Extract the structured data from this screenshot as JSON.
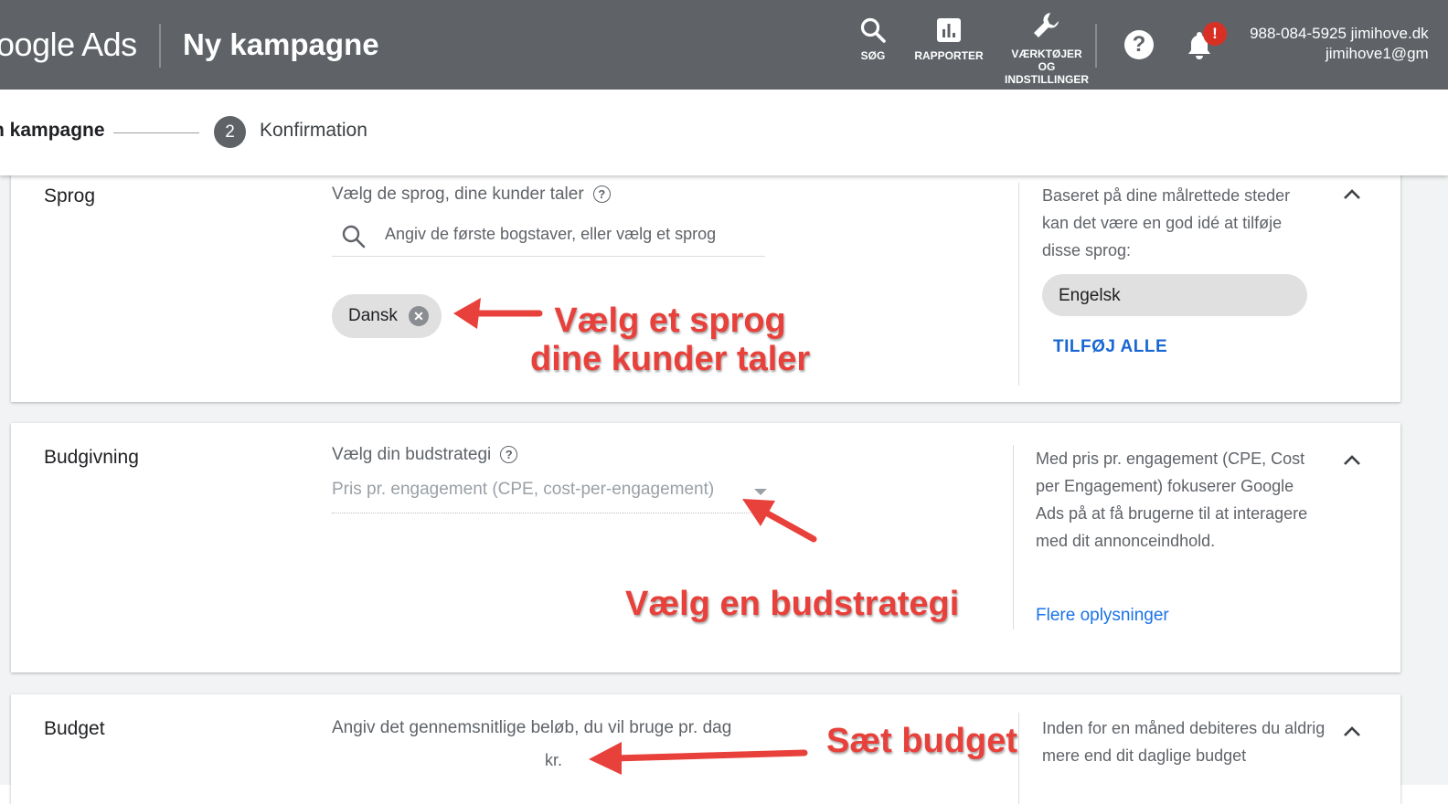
{
  "header": {
    "logo": "oogle Ads",
    "page_title": "Ny kampagne",
    "tools": [
      {
        "label": "SØG",
        "icon": "search-icon"
      },
      {
        "label": "RAPPORTER",
        "icon": "reports-icon"
      },
      {
        "label": "VÆRKTØJER\nOG\nINDSTILLINGER",
        "icon": "wrench-icon"
      }
    ],
    "help_icon": "?",
    "notification_badge": "!",
    "account_line1": "988-084-5925 jimihove.dk",
    "account_line2": "jimihove1@gm"
  },
  "stepper": {
    "step1_label": "n kampagne",
    "step2_number": "2",
    "step2_label": "Konfirmation"
  },
  "sprog": {
    "title": "Sprog",
    "label": "Vælg de sprog, dine kunder taler",
    "search_placeholder": "Angiv de første bogstaver, eller vælg et sprog",
    "selected_chip": "Dansk",
    "side_text": "Baseret på dine målrettede steder kan det være en god idé at tilføje disse sprog:",
    "suggestion": "Engelsk",
    "add_all": "TILFØJ ALLE"
  },
  "budgivning": {
    "title": "Budgivning",
    "label": "Vælg din budstrategi",
    "selected_value": "Pris pr. engagement (CPE, cost-per-engagement)",
    "side_text": "Med pris pr. engagement (CPE, Cost per Engagement) fokuserer Google Ads på at få brugerne til at interagere med dit annonceindhold.",
    "more_info": "Flere oplysninger"
  },
  "budget": {
    "title": "Budget",
    "label": "Angiv det gennemsnitlige beløb, du vil bruge pr. dag",
    "currency": "kr.",
    "side_text": "Inden for en måned debiteres du aldrig mere end dit daglige budget"
  },
  "annotations": {
    "sprog": "Vælg et sprog\ndine kunder taler",
    "budstrategi": "Vælg en budstrategi",
    "budget": "Sæt budget"
  },
  "colors": {
    "header_bg": "#5f6368",
    "accent_link": "#1a73e8",
    "annotation_red": "#e8403a",
    "badge_red": "#d93025"
  }
}
